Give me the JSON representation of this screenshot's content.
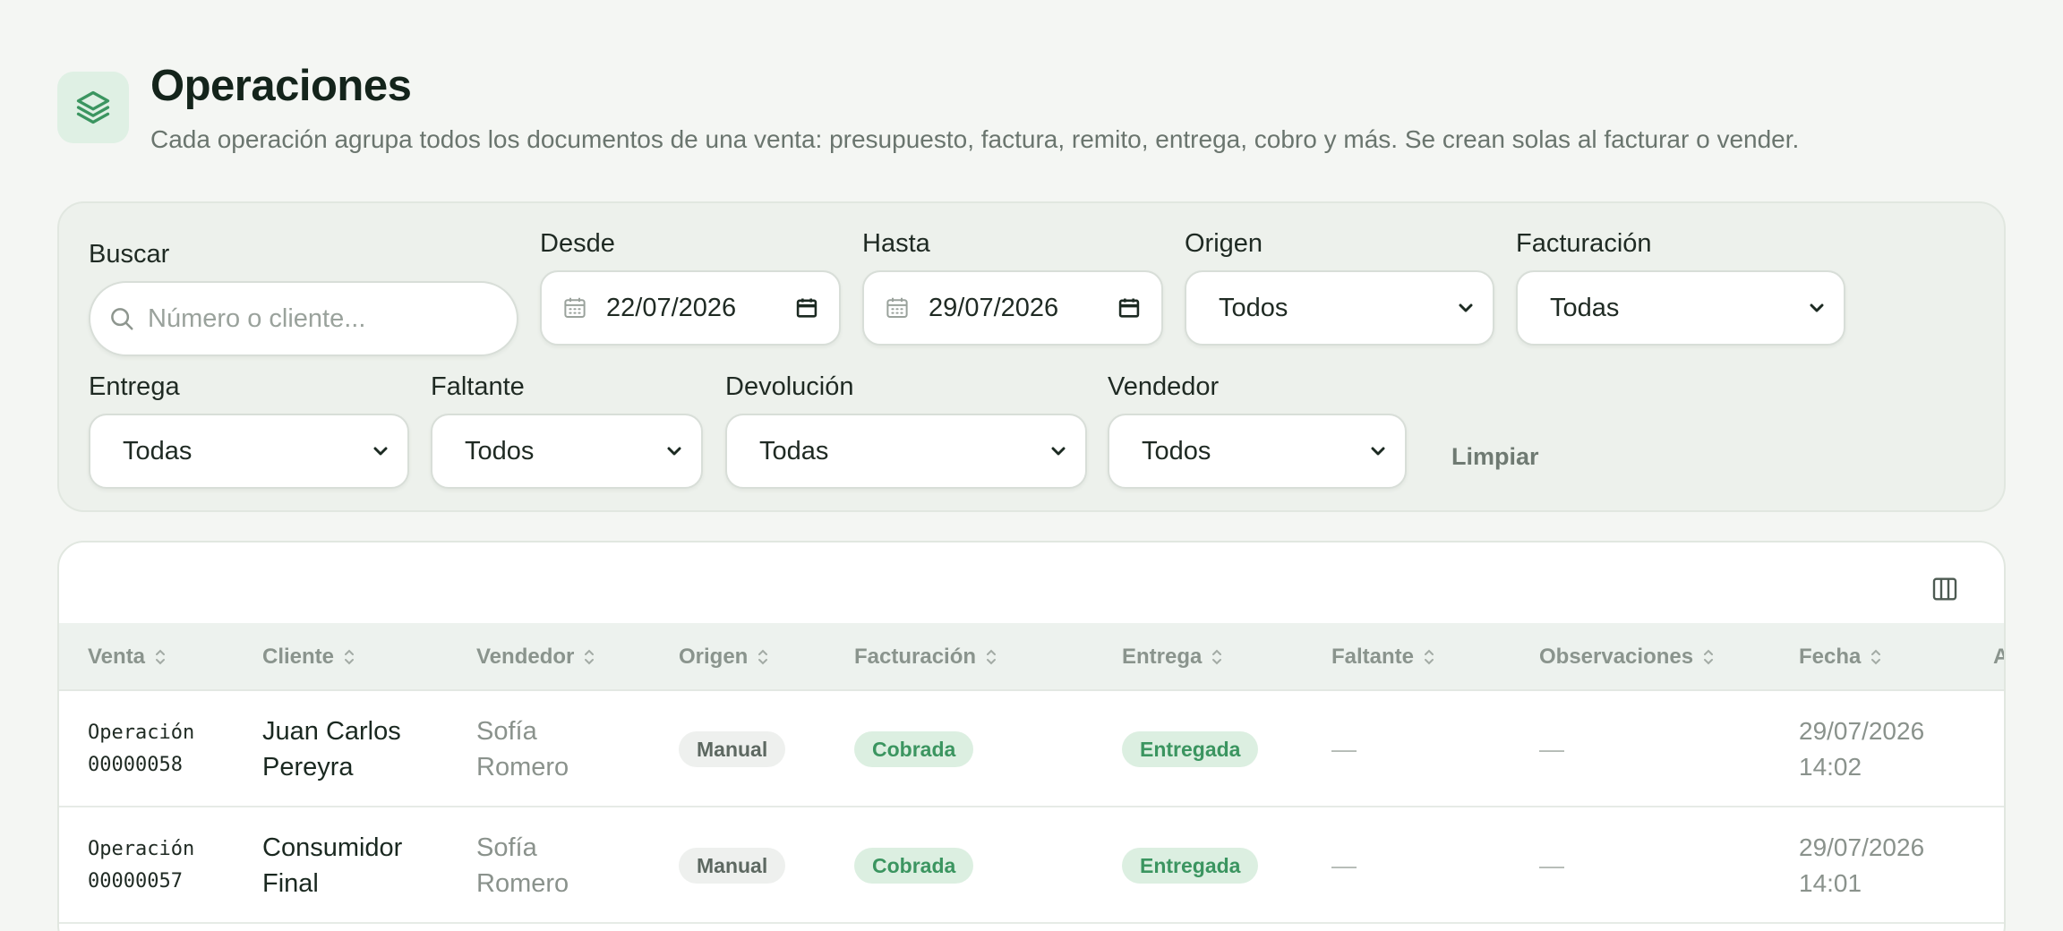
{
  "header": {
    "icon": "layers-icon",
    "title": "Operaciones",
    "subtitle": "Cada operación agrupa todos los documentos de una venta: presupuesto, factura, remito, entrega, cobro y más. Se crean solas al facturar o vender."
  },
  "filters": {
    "search": {
      "label": "Buscar",
      "placeholder": "Número o cliente..."
    },
    "desde": {
      "label": "Desde",
      "value": "22/07/2026"
    },
    "hasta": {
      "label": "Hasta",
      "value": "29/07/2026"
    },
    "origen": {
      "label": "Origen",
      "value": "Todos"
    },
    "facturacion": {
      "label": "Facturación",
      "value": "Todas"
    },
    "entrega": {
      "label": "Entrega",
      "value": "Todas"
    },
    "faltante": {
      "label": "Faltante",
      "value": "Todos"
    },
    "devolucion": {
      "label": "Devolución",
      "value": "Todas"
    },
    "vendedor": {
      "label": "Vendedor",
      "value": "Todos"
    },
    "clear_label": "Limpiar"
  },
  "table": {
    "columns": [
      "Venta",
      "Cliente",
      "Vendedor",
      "Origen",
      "Facturación",
      "Entrega",
      "Faltante",
      "Observaciones",
      "Fecha",
      "A"
    ],
    "rows": [
      {
        "venta_line1": "Operación",
        "venta_line2": "00000058",
        "cliente_line1": "Juan Carlos",
        "cliente_line2": "Pereyra",
        "vendedor_line1": "Sofía",
        "vendedor_line2": "Romero",
        "origen": "Manual",
        "facturacion": "Cobrada",
        "entrega": "Entregada",
        "faltante": "—",
        "observaciones": "—",
        "fecha_line1": "29/07/2026",
        "fecha_line2": "14:02"
      },
      {
        "venta_line1": "Operación",
        "venta_line2": "00000057",
        "cliente_line1": "Consumidor",
        "cliente_line2": "Final",
        "vendedor_line1": "Sofía",
        "vendedor_line2": "Romero",
        "origen": "Manual",
        "facturacion": "Cobrada",
        "entrega": "Entregada",
        "faltante": "—",
        "observaciones": "—",
        "fecha_line1": "29/07/2026",
        "fecha_line2": "14:01"
      }
    ]
  },
  "colors": {
    "accent_green": "#3b9560",
    "badge_green_bg": "#dcefe1",
    "page_bg": "#f4f6f3"
  }
}
